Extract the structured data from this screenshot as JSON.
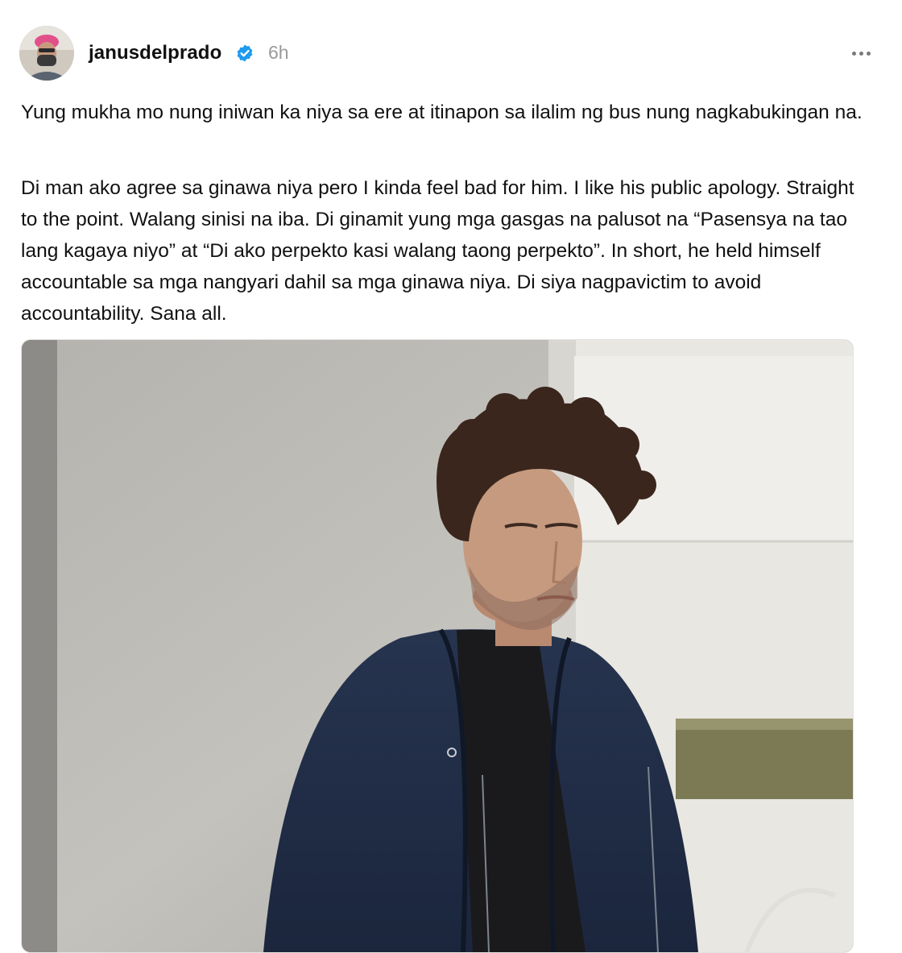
{
  "post": {
    "username": "janusdelprado",
    "timestamp": "6h",
    "paragraphs": [
      "Yung mukha mo nung iniwan ka niya sa ere at itinapon sa ilalim ng bus nung nagkabukingan na.",
      "Di man ako agree sa ginawa niya pero I kinda feel bad for him. I like his public apology. Straight to the point. Walang sinisi na iba. Di ginamit yung mga gasgas na palusot na “Pasensya na tao lang kagaya niyo” at “Di ako perpekto kasi walang taong perpekto”. In short, he held himself accountable sa mga nangyari dahil sa mga ginawa niya. Di siya nagpavictim to avoid accountability. Sana all."
    ]
  },
  "icons": {
    "verified": "verified-badge-icon",
    "more": "more-options-icon"
  },
  "colors": {
    "verified_blue": "#1d9bf0",
    "timestamp_gray": "#9a9a9a",
    "text": "#111111"
  }
}
